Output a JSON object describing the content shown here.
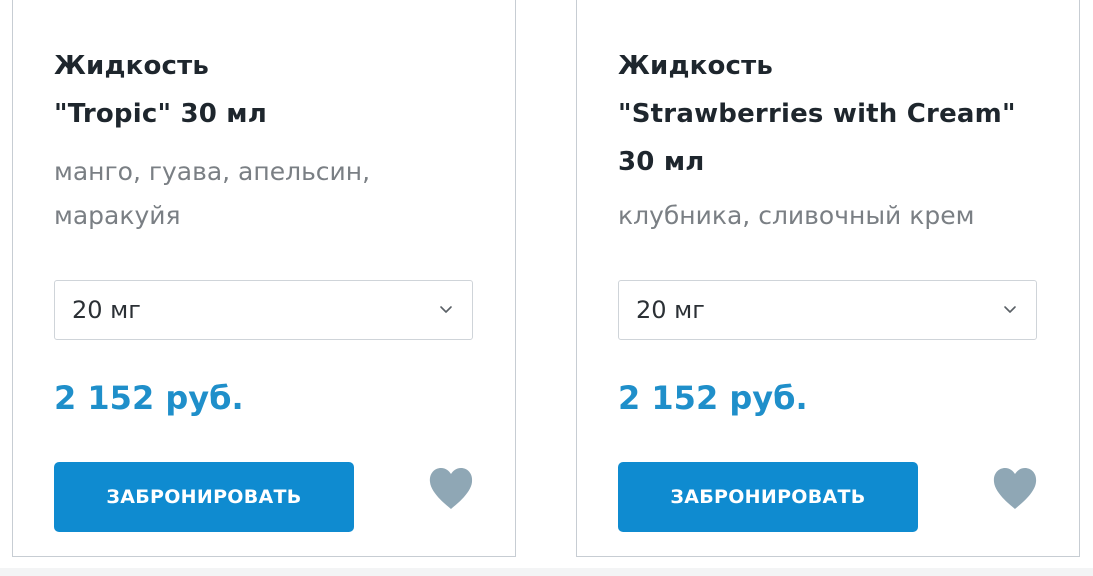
{
  "products": [
    {
      "title_lines": [
        "Жидкость",
        "\"Tropic\" 30 мл"
      ],
      "description_lines": [
        "манго, гуава, апельсин,",
        "маракуйя"
      ],
      "strength_select": {
        "value": "20 мг"
      },
      "price": "2 152 руб.",
      "book_label": "ЗАБРОНИРОВАТЬ"
    },
    {
      "title_lines": [
        "Жидкость",
        "\"Strawberries with Cream\"",
        "30 мл"
      ],
      "description_lines": [
        "клубника, сливочный крем"
      ],
      "strength_select": {
        "value": "20 мг"
      },
      "price": "2 152 руб.",
      "book_label": "ЗАБРОНИРОВАТЬ"
    }
  ],
  "icons": {
    "select": "chevron-down-icon",
    "favorite": "heart-icon"
  },
  "colors": {
    "accent": "#0f8bd0",
    "price": "#1f8fca",
    "title": "#1e262d",
    "description": "#7a7f84",
    "heart": "#8fa7b5",
    "border": "#c7cdd3"
  }
}
